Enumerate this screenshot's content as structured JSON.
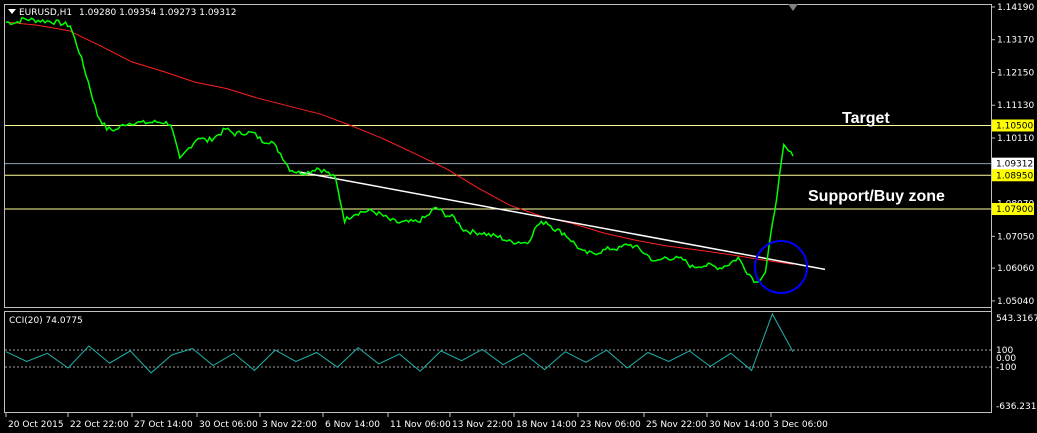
{
  "header": {
    "symbol": "EURUSD,H1",
    "ohlc": "1.09280 1.09354 1.09273 1.09312",
    "collapse_icon": "triangle-down-icon"
  },
  "indicator": {
    "label": "CCI(20) 74.0775",
    "ticks": [
      "543.3167",
      "100",
      "0.00",
      "-100",
      "-636.231"
    ]
  },
  "annotations": {
    "target": "Target",
    "support": "Support/Buy zone"
  },
  "colors": {
    "price": "#00ff00",
    "ma": "#ff2020",
    "trendline": "#ffffff",
    "level": "#ffff99",
    "tag": "#ffff00",
    "cci": "#20b2aa",
    "circle": "#0000ff"
  },
  "chart_data": [
    {
      "type": "line",
      "price_ticks": [
        "1.14190",
        "1.13170",
        "1.12150",
        "1.11130",
        "1.10110",
        "1.08070",
        "1.07050",
        "1.06060",
        "1.05040"
      ],
      "price_tags": [
        {
          "label": "1.10500",
          "value": 1.105,
          "highlight": true
        },
        {
          "label": "1.09312",
          "value": 1.09312,
          "highlight": false
        },
        {
          "label": "1.08950",
          "value": 1.0895,
          "highlight": true
        },
        {
          "label": "1.07900",
          "value": 1.079,
          "highlight": true
        }
      ],
      "ylim": [
        1.0485,
        1.1425
      ],
      "x_ticks": [
        "20 Oct 2015",
        "22 Oct 22:00",
        "27 Oct 14:00",
        "30 Oct 06:00",
        "3 Nov 22:00",
        "6 Nov 14:00",
        "11 Nov 06:00",
        "13 Nov 22:00",
        "18 Nov 14:00",
        "23 Nov 06:00",
        "25 Nov 22:00",
        "30 Nov 14:00",
        "3 Dec 06:00"
      ],
      "series": [
        {
          "values": [
            1.1372,
            1.137,
            1.1382,
            1.1378,
            1.1376,
            1.1374,
            1.1368,
            1.1361,
            1.128,
            1.1185,
            1.1082,
            1.104,
            1.1036,
            1.1055,
            1.106,
            1.1058,
            1.106,
            1.1061,
            1.1055,
            1.0942,
            1.098,
            1.1014,
            1.1002,
            1.1017,
            1.1039,
            1.1024,
            1.1028,
            1.1026,
            1.1003,
            1.1,
            1.0963,
            1.0915,
            1.0903,
            1.0905,
            1.0918,
            1.0906,
            1.0885,
            1.0755,
            1.0775,
            1.0782,
            1.0784,
            1.0772,
            1.0755,
            1.0747,
            1.0749,
            1.0751,
            1.0767,
            1.0795,
            1.0773,
            1.0762,
            1.0726,
            1.0718,
            1.0716,
            1.0708,
            1.0702,
            1.0688,
            1.0688,
            1.0685,
            1.0738,
            1.0752,
            1.0727,
            1.0714,
            1.0686,
            1.0656,
            1.0651,
            1.0658,
            1.0667,
            1.0667,
            1.0681,
            1.0669,
            1.0648,
            1.0624,
            1.0639,
            1.0637,
            1.0632,
            1.0609,
            1.0615,
            1.0614,
            1.0607,
            1.0619,
            1.0638,
            1.0595,
            1.0561,
            1.0595,
            1.0788,
            1.0985,
            1.0955
          ]
        },
        {
          "values": [
            1.1372,
            1.1362,
            1.1345,
            1.1298,
            1.1248,
            1.1218,
            1.1185,
            1.1165,
            1.1135,
            1.111,
            1.1085,
            1.1048,
            1.1008,
            1.0962,
            1.0915,
            1.0855,
            1.0802,
            1.0768,
            1.0745,
            1.0715,
            1.0693,
            1.0675,
            1.0662,
            1.0648,
            1.0632,
            1.0618
          ]
        },
        {
          "values": [
            1.0905,
            1.0602
          ]
        },
        {
          "values": [
            80,
            -40,
            60,
            -120,
            150,
            -60,
            90,
            -180,
            40,
            120,
            -90,
            60,
            -150,
            100,
            -40,
            70,
            -110,
            130,
            -70,
            50,
            -160,
            90,
            -30,
            110,
            -80,
            60,
            -140,
            80,
            -50,
            100,
            -120,
            70,
            -40,
            90,
            -100,
            60,
            -150,
            543,
            80
          ]
        }
      ],
      "cci_ylim": [
        -636.231,
        543.3167
      ]
    }
  ]
}
